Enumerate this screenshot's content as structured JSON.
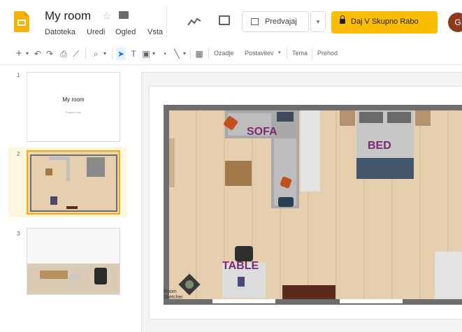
{
  "header": {
    "doc_title": "My room",
    "menus": [
      "Datoteka",
      "Uredi",
      "Ogled",
      "Vsta"
    ],
    "present_label": "Predvajaj",
    "share_label": "Daj V Skupno Rabo",
    "avatar_initial": "G"
  },
  "toolbar": {
    "text_items": [
      "Ozadje",
      "Postavitev",
      "Tema",
      "Prehod"
    ]
  },
  "filmstrip": {
    "slides": [
      {
        "number": "1",
        "title": "My room",
        "subtitle": "Project room"
      },
      {
        "number": "2"
      },
      {
        "number": "3"
      }
    ]
  },
  "floorplan": {
    "labels": {
      "sofa": "SOFA",
      "bed": "BED",
      "table": "TABLE"
    },
    "watermark": [
      "Room",
      "Sketcher"
    ]
  },
  "colors": {
    "accent_yellow": "#fbbc04",
    "selected_border": "#f9ab00",
    "label_purple": "#7a2a72",
    "wall_grey": "#6e6e6e",
    "floor_wood": "#e6cfae"
  },
  "icons": [
    "docs-logo-icon",
    "star-icon",
    "folder-icon",
    "activity-trend-icon",
    "comment-icon",
    "present-icon",
    "lock-icon",
    "add-icon",
    "undo-icon",
    "redo-icon",
    "print-icon",
    "paint-format-icon",
    "zoom-icon",
    "select-cursor-icon",
    "text-box-icon",
    "image-icon",
    "shape-icon",
    "line-icon",
    "comment-insert-icon"
  ]
}
